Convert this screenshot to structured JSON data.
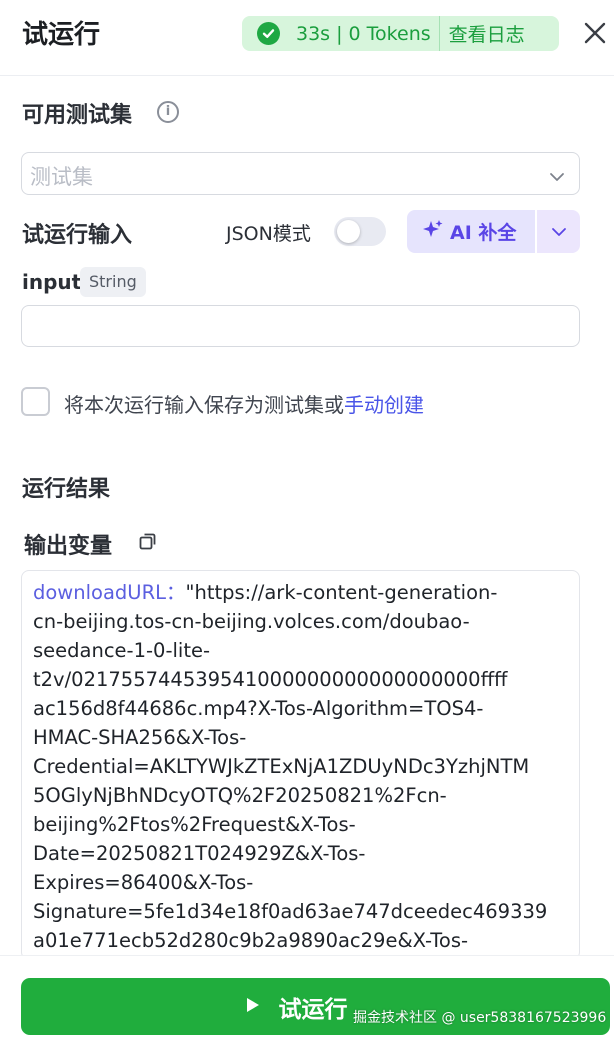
{
  "header": {
    "title": "试运行",
    "status_text": "33s | 0 Tokens",
    "view_log_label": "查看日志"
  },
  "testset": {
    "label": "可用测试集",
    "placeholder": "测试集"
  },
  "run_input": {
    "label": "试运行输入",
    "json_mode_label": "JSON模式",
    "json_mode_on": false,
    "ai_button_label": "AI 补全",
    "field_name": "input",
    "field_type": "String",
    "field_value": ""
  },
  "save_option": {
    "text": "将本次运行输入保存为测试集或",
    "link": "手动创建"
  },
  "results": {
    "label": "运行结果",
    "output_vars_label": "输出变量",
    "output_key": "downloadURL：",
    "output_lines": [
      "\"https://ark-content-generation-",
      "cn-beijing.tos-cn-beijing.volces.com/doubao-",
      "seedance-1-0-lite-",
      "t2v/021755744539541000000000000000000ffff",
      "ac156d8f44686c.mp4?X-Tos-Algorithm=TOS4-",
      "HMAC-SHA256&X-Tos-",
      "Credential=AKLTYWJkZTExNjA1ZDUyNDc3YzhjNTM",
      "5OGlyNjBhNDcyOTQ%2F20250821%2Fcn-",
      "beijing%2Ftos%2Frequest&X-Tos-",
      "Date=20250821T024929Z&X-Tos-",
      "Expires=86400&X-Tos-",
      "Signature=5fe1d34e18f0ad63ae747dceedec469339",
      "a01e771ecb52d280c9b2a9890ac29e&X-Tos-"
    ]
  },
  "footer": {
    "run_button_label": "试运行",
    "watermark": "掘金技术社区 @ user5838167523996"
  },
  "colors": {
    "accent_green": "#20ad3d",
    "status_pill_bg": "#d7f5dc",
    "ai_purple": "#5a45e6",
    "link_blue": "#4a55e8"
  }
}
